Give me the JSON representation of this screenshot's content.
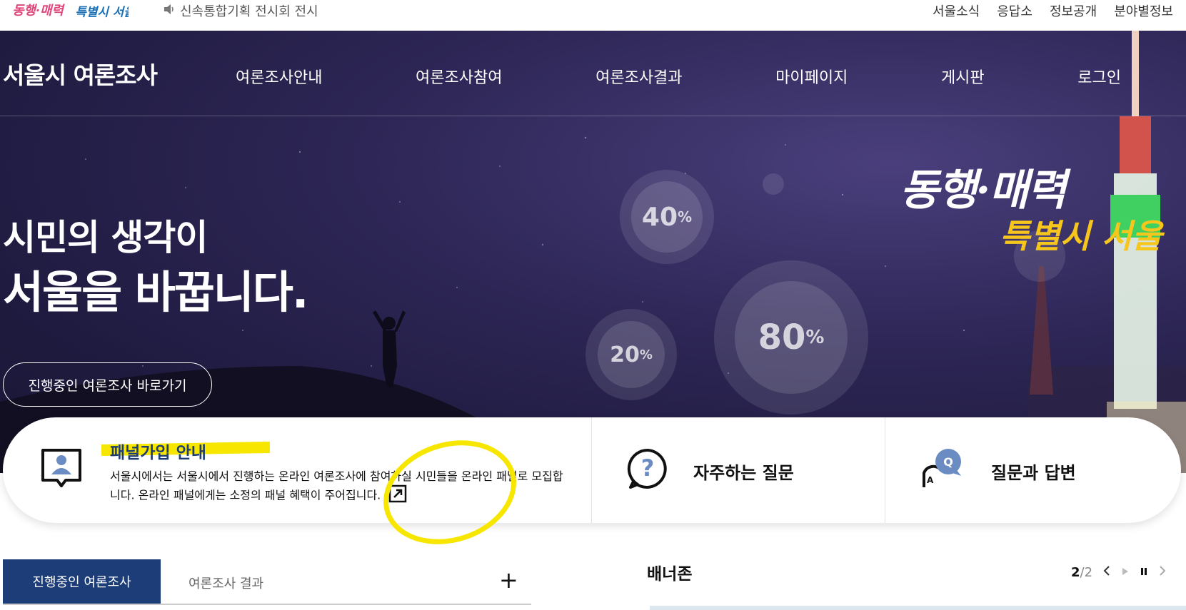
{
  "topbar": {
    "notice_icon": "speaker-icon",
    "notice_text": "신속통합기획 전시회 전시",
    "links": [
      "서울소식",
      "응답소",
      "정보공개",
      "분야별정보"
    ]
  },
  "nav": {
    "site_title": "서울시 여론조사",
    "menu": [
      "여론조사안내",
      "여론조사참여",
      "여론조사결과",
      "마이페이지",
      "게시판",
      "로그인"
    ]
  },
  "hero": {
    "headline1": "시민의 생각이",
    "headline2": "서울을 바꿉니다.",
    "cta_label": "진행중인 여론조사 바로가기",
    "bubbles": [
      {
        "num": "40",
        "unit": "%"
      },
      {
        "num": "20",
        "unit": "%"
      },
      {
        "num": "80",
        "unit": "%"
      }
    ],
    "slogan_line1": "동행·매력",
    "slogan_line2": "특별시 서울"
  },
  "cards": {
    "panel": {
      "title": "패널가입 안내",
      "desc": "서울시에서는 서울시에서 진행하는 온라인 여론조사에 참여하실 시민들을 온라인 패널로 모집합니다. 온라인 패널에게는 소정의 패널 혜택이 주어집니다.",
      "icon": "person-chat-icon"
    },
    "faq": {
      "title": "자주하는 질문",
      "icon": "question-bubble-icon"
    },
    "qna": {
      "title": "질문과 답변",
      "icon": "qa-bubble-icon"
    }
  },
  "survey_tabs": {
    "active": "진행중인 여론조사",
    "second": "여론조사 결과",
    "more": "+"
  },
  "banner": {
    "title": "배너존",
    "current": "2",
    "separator": "/",
    "total": "2"
  },
  "colors": {
    "hero_bg": "#231e48",
    "nav_active": "#1d3d78",
    "highlight": "#f7e600",
    "slogan_yellow": "#f6c61c"
  }
}
